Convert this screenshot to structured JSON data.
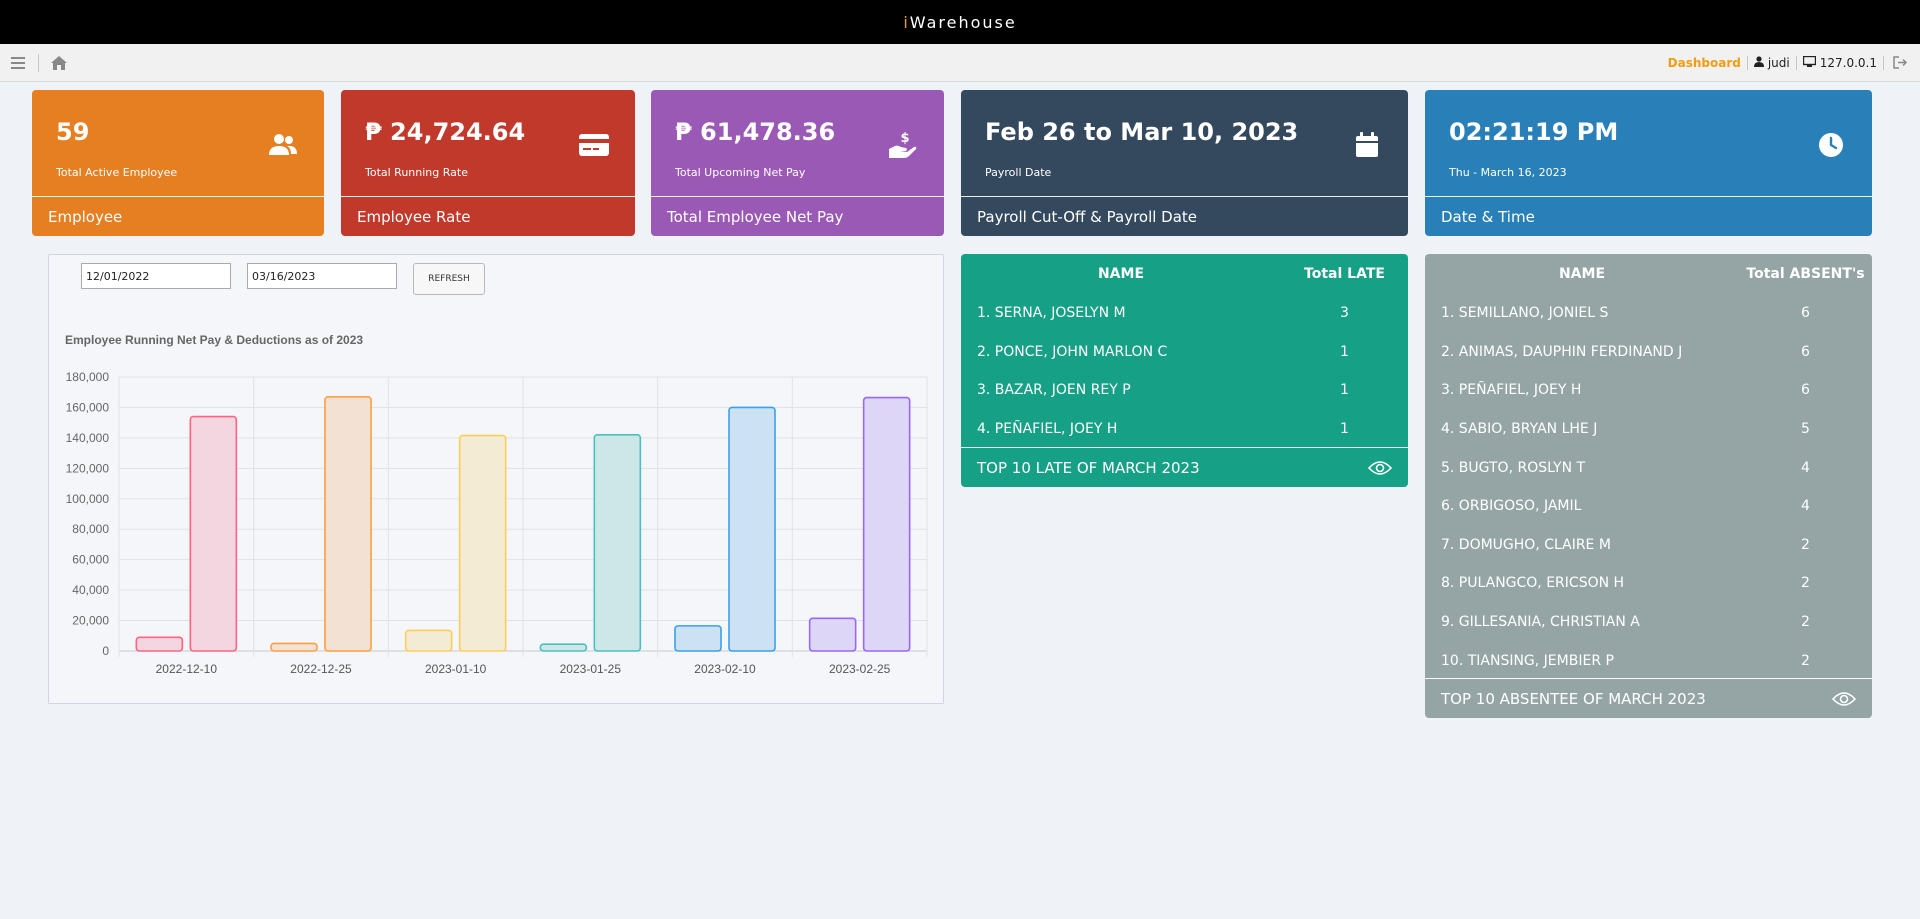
{
  "app": {
    "brand_prefix": "i",
    "brand_rest": "Warehouse"
  },
  "toolbar": {
    "menu_icon": "menu-icon",
    "home_icon": "home-icon",
    "dashboard_label": "Dashboard",
    "user_icon": "user-icon",
    "username": "judi",
    "monitor_icon": "monitor-icon",
    "ip": "127.0.0.1",
    "logout_icon": "logout-icon"
  },
  "cards": [
    {
      "value": "59",
      "sub": "Total Active Employee",
      "footer": "Employee",
      "icon": "users-icon",
      "color": "#e67e22"
    },
    {
      "value": "₱ 24,724.64",
      "sub": "Total Running Rate",
      "footer": "Employee Rate",
      "icon": "credit-card-icon",
      "color": "#c0392b"
    },
    {
      "value": "₱ 61,478.36",
      "sub": "Total Upcoming Net Pay",
      "footer": "Total Employee Net Pay",
      "icon": "hand-dollar-icon",
      "color": "#9b59b6"
    },
    {
      "value": "Feb 26 to Mar 10, 2023",
      "sub": "Payroll Date",
      "footer": "Payroll Cut-Off & Payroll Date",
      "icon": "calendar-icon",
      "color": "#34495e"
    },
    {
      "value": "02:21:19 PM",
      "sub": "Thu - March 16, 2023",
      "footer": "Date & Time",
      "icon": "clock-icon",
      "color": "#2980b9"
    }
  ],
  "filters": {
    "date_from": "12/01/2022",
    "date_to": "03/16/2023",
    "refresh_label": "REFRESH"
  },
  "chart_data": {
    "type": "bar",
    "title": "Employee Running Net Pay & Deductions as of 2023",
    "categories": [
      "2022-12-10",
      "2022-12-25",
      "2023-01-10",
      "2023-01-25",
      "2023-02-10",
      "2023-02-25"
    ],
    "series": [
      {
        "values": [
          9000,
          5000,
          13500,
          4500,
          16500,
          21500
        ]
      },
      {
        "values": [
          154000,
          167000,
          141500,
          142000,
          160000,
          166500
        ]
      }
    ],
    "bar_colors": [
      {
        "stroke": "#ff6384",
        "fill": "#f3d6df"
      },
      {
        "stroke": "#ff9f40",
        "fill": "#f3e1d3"
      },
      {
        "stroke": "#ffcd56",
        "fill": "#f3ebd3"
      },
      {
        "stroke": "#4bc0c0",
        "fill": "#cde7e9"
      },
      {
        "stroke": "#36a2eb",
        "fill": "#cce1f3"
      },
      {
        "stroke": "#9966ff",
        "fill": "#ddd6f7"
      }
    ],
    "ylim": [
      0,
      180000
    ],
    "yticks": [
      "0",
      "20,000",
      "40,000",
      "60,000",
      "80,000",
      "100,000",
      "120,000",
      "140,000",
      "160,000",
      "180,000"
    ],
    "grid": true
  },
  "late_table": {
    "col_name": "NAME",
    "col_total": "Total LATE",
    "rows": [
      {
        "name": "1. SERNA, JOSELYN M",
        "total": "3"
      },
      {
        "name": "2. PONCE, JOHN MARLON C",
        "total": "1"
      },
      {
        "name": "3. BAZAR, JOEN REY P",
        "total": "1"
      },
      {
        "name": "4. PEÑAFIEL, JOEY H",
        "total": "1"
      }
    ],
    "footer": "TOP 10 LATE OF MARCH 2023",
    "footer_icon": "eye-icon"
  },
  "absent_table": {
    "col_name": "NAME",
    "col_total": "Total ABSENT's",
    "rows": [
      {
        "name": "1. SEMILLANO, JONIEL S",
        "total": "6"
      },
      {
        "name": "2. ANIMAS, DAUPHIN FERDINAND J",
        "total": "6"
      },
      {
        "name": "3. PEÑAFIEL, JOEY H",
        "total": "6"
      },
      {
        "name": "4. SABIO, BRYAN LHE J",
        "total": "5"
      },
      {
        "name": "5. BUGTO, ROSLYN T",
        "total": "4"
      },
      {
        "name": "6. ORBIGOSO, JAMIL",
        "total": "4"
      },
      {
        "name": "7. DOMUGHO, CLAIRE M",
        "total": "2"
      },
      {
        "name": "8. PULANGCO, ERICSON H",
        "total": "2"
      },
      {
        "name": "9. GILLESANIA, CHRISTIAN A",
        "total": "2"
      },
      {
        "name": "10. TIANSING, JEMBIER P",
        "total": "2"
      }
    ],
    "footer": "TOP 10 ABSENTEE OF MARCH 2023",
    "footer_icon": "eye-icon"
  }
}
